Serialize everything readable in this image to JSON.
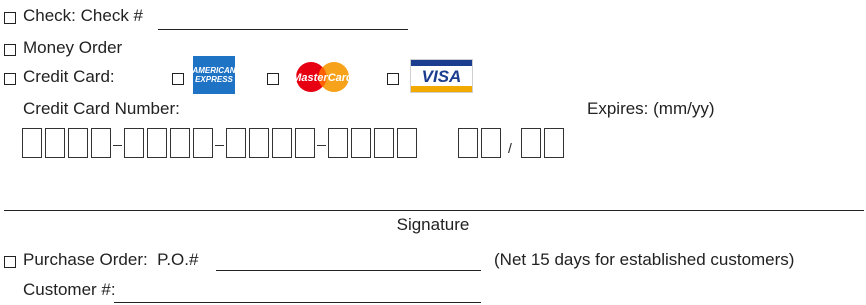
{
  "payment": {
    "check": {
      "label": "Check: Check #"
    },
    "money_order": {
      "label": "Money Order"
    },
    "credit_card": {
      "label": "Credit Card:",
      "cards": [
        {
          "name": "American Express",
          "logo_line1": "AMERICAN",
          "logo_line2": "EXPRESS",
          "color": "#1f73c4"
        },
        {
          "name": "MasterCard",
          "logo_text": "MasterCard",
          "colors": [
            "#e60012",
            "#f7a21b"
          ]
        },
        {
          "name": "Visa",
          "logo_text": "VISA",
          "colors": [
            "#1a3d8f",
            "#f2a900"
          ]
        }
      ],
      "number_label": "Credit Card Number:",
      "expires_label": "Expires: (mm/yy)",
      "expires_separator": "/"
    },
    "signature": {
      "label": "Signature"
    },
    "purchase_order": {
      "label": "Purchase Order:  P.O.#",
      "terms": "(Net 15 days for established customers)"
    },
    "customer": {
      "label": "Customer #:"
    }
  }
}
